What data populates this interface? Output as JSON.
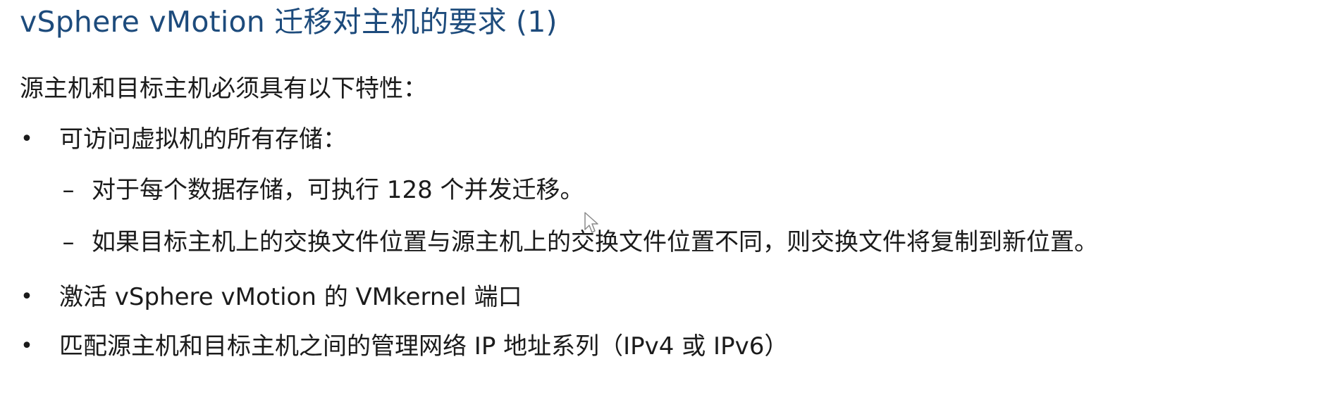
{
  "title": "vSphere vMotion 迁移对主机的要求 (1)",
  "intro": "源主机和目标主机必须具有以下特性：",
  "bullet_symbol": "•",
  "dash_symbol": "–",
  "items": [
    {
      "text": "可访问虚拟机的所有存储：",
      "subitems": [
        "对于每个数据存储，可执行 128 个并发迁移。",
        "如果目标主机上的交换文件位置与源主机上的交换文件位置不同，则交换文件将复制到新位置。"
      ]
    },
    {
      "text": "激活 vSphere vMotion 的 VMkernel 端口"
    },
    {
      "text": "匹配源主机和目标主机之间的管理网络 IP 地址系列（IPv4 或 IPv6）"
    }
  ],
  "colors": {
    "title": "#1d4b7c",
    "body_text": "#1b1b1b",
    "background": "#ffffff"
  },
  "icons": {
    "cursor": "mouse-pointer-icon"
  }
}
